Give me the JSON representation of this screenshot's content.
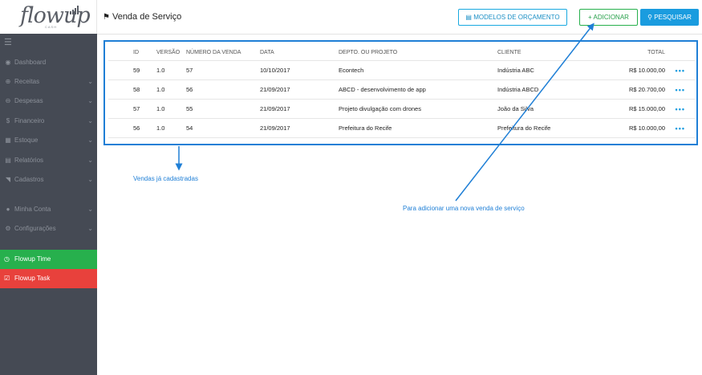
{
  "brand": {
    "logo_text": "flowup",
    "logo_sub": "CASH"
  },
  "sidebar": {
    "menu_icon": "hamburger-icon",
    "items": [
      {
        "label": "Dashboard",
        "icon": "dashboard-icon",
        "chevron": false
      },
      {
        "label": "Receitas",
        "icon": "plus-circle-icon",
        "chevron": true
      },
      {
        "label": "Despesas",
        "icon": "minus-circle-icon",
        "chevron": true
      },
      {
        "label": "Financeiro",
        "icon": "dollar-icon",
        "chevron": true
      },
      {
        "label": "Estoque",
        "icon": "grid-icon",
        "chevron": true
      },
      {
        "label": "Relatórios",
        "icon": "report-icon",
        "chevron": true
      },
      {
        "label": "Cadastros",
        "icon": "folder-icon",
        "chevron": true
      },
      {
        "label": "Minha Conta",
        "icon": "user-icon",
        "chevron": true
      },
      {
        "label": "Configurações",
        "icon": "cogs-icon",
        "chevron": true
      }
    ],
    "flowup_time": "Flowup Time",
    "flowup_task": "Flowup Task"
  },
  "header": {
    "title": "Venda de Serviço",
    "btn_models": "MODELOS DE ORÇAMENTO",
    "btn_add": "ADICIONAR",
    "btn_search": "PESQUISAR"
  },
  "table": {
    "columns": [
      "ID",
      "VERSÃO",
      "NÚMERO DA VENDA",
      "DATA",
      "DEPTO. OU PROJETO",
      "CLIENTE",
      "TOTAL"
    ],
    "rows": [
      {
        "id": "59",
        "versao": "1.0",
        "numero": "57",
        "data": "10/10/2017",
        "depto": "Econtech",
        "cliente": "Indústria ABC",
        "total": "R$ 10.000,00"
      },
      {
        "id": "58",
        "versao": "1.0",
        "numero": "56",
        "data": "21/09/2017",
        "depto": "ABCD - desenvolvimento de app",
        "cliente": "Indústria ABCD",
        "total": "R$ 20.700,00"
      },
      {
        "id": "57",
        "versao": "1.0",
        "numero": "55",
        "data": "21/09/2017",
        "depto": "Projeto divulgação com drones",
        "cliente": "João da Silva",
        "total": "R$ 15.000,00"
      },
      {
        "id": "56",
        "versao": "1.0",
        "numero": "54",
        "data": "21/09/2017",
        "depto": "Prefeitura do Recife",
        "cliente": "Prefeitura do Recife",
        "total": "R$ 10.000,00"
      }
    ],
    "more_label": "•••"
  },
  "annotations": {
    "vendas": "Vendas já cadastradas",
    "adicionar": "Para adicionar uma nova venda de serviço"
  },
  "colors": {
    "accent_blue": "#1a9cdf",
    "green": "#27b04d",
    "red": "#e8413c",
    "sidebar": "#454a54",
    "annotation": "#1f7fd6"
  }
}
